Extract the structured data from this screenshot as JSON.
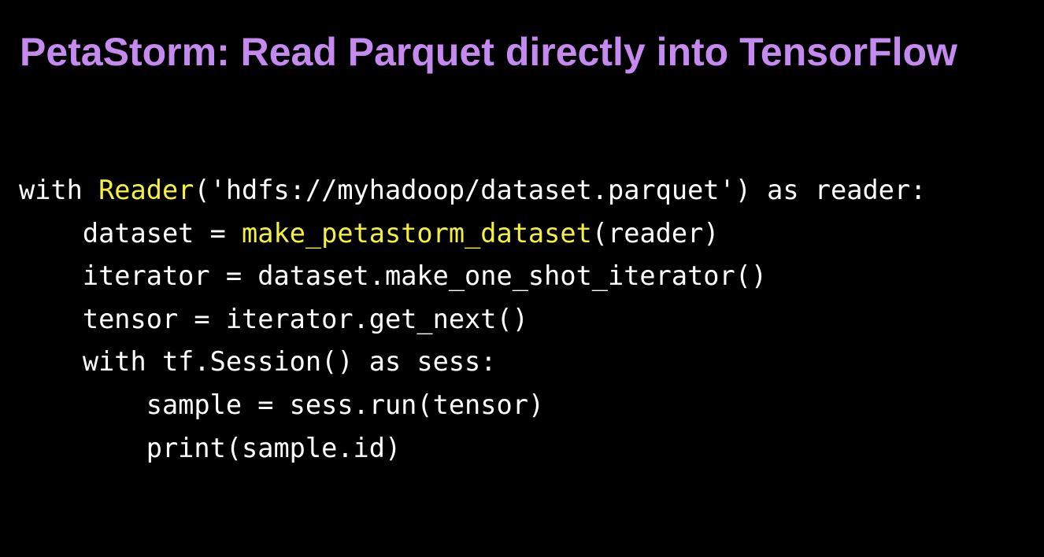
{
  "slide": {
    "title": "PetaStorm: Read Parquet directly into TensorFlow",
    "colors": {
      "background": "#000000",
      "title": "#c58af0",
      "code_text": "#ffffff",
      "code_highlight": "#f5f03d"
    }
  },
  "code": {
    "lines": [
      {
        "indent": "",
        "segments": [
          {
            "text": "with ",
            "highlight": false
          },
          {
            "text": "Reader",
            "highlight": true
          },
          {
            "text": "('hdfs://myhadoop/dataset.parquet') as reader:",
            "highlight": false
          }
        ]
      },
      {
        "indent": "    ",
        "segments": [
          {
            "text": "dataset = ",
            "highlight": false
          },
          {
            "text": "make_petastorm_dataset",
            "highlight": true
          },
          {
            "text": "(reader)",
            "highlight": false
          }
        ]
      },
      {
        "indent": "    ",
        "segments": [
          {
            "text": "iterator = dataset.make_one_shot_iterator()",
            "highlight": false
          }
        ]
      },
      {
        "indent": "    ",
        "segments": [
          {
            "text": "tensor = iterator.get_next()",
            "highlight": false
          }
        ]
      },
      {
        "indent": "    ",
        "segments": [
          {
            "text": "with tf.Session() as sess:",
            "highlight": false
          }
        ]
      },
      {
        "indent": "        ",
        "segments": [
          {
            "text": "sample = sess.run(tensor)",
            "highlight": false
          }
        ]
      },
      {
        "indent": "        ",
        "segments": [
          {
            "text": "print(sample.id)",
            "highlight": false
          }
        ]
      }
    ]
  }
}
